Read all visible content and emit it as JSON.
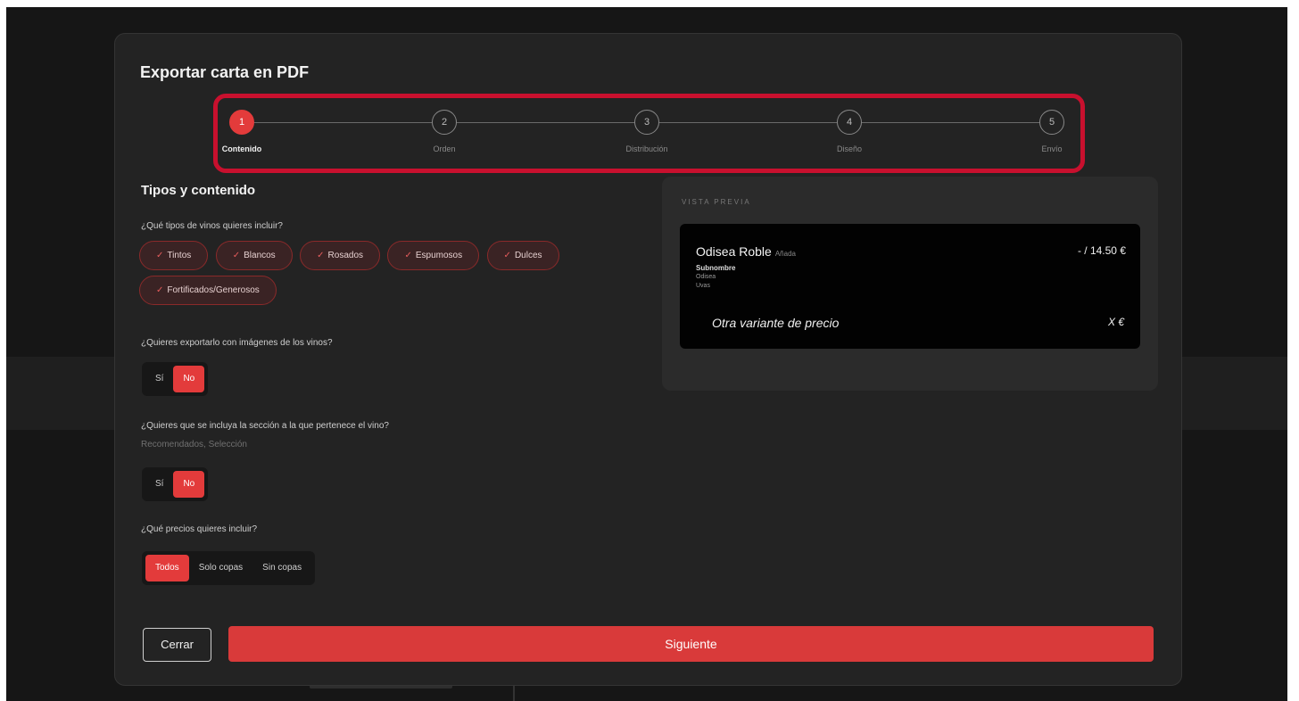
{
  "dialog": {
    "title": "Exportar carta en PDF"
  },
  "stepper": {
    "steps": [
      {
        "number": "1",
        "label": "Contenido",
        "active": true
      },
      {
        "number": "2",
        "label": "Orden",
        "active": false
      },
      {
        "number": "3",
        "label": "Distribución",
        "active": false
      },
      {
        "number": "4",
        "label": "Diseño",
        "active": false
      },
      {
        "number": "5",
        "label": "Envío",
        "active": false
      }
    ],
    "highlight_color": "#c8102e"
  },
  "content": {
    "section_title": "Tipos y contenido",
    "wine_types": {
      "question": "¿Qué tipos de vinos quieres incluir?",
      "check_glyph": "✓",
      "options": [
        "Tintos",
        "Blancos",
        "Rosados",
        "Espumosos",
        "Dulces",
        "Fortificados/Generosos"
      ]
    },
    "images": {
      "question": "¿Quieres exportarlo con imágenes de los vinos?",
      "yes": "Sí",
      "no": "No",
      "selected": "No"
    },
    "section_include": {
      "question": "¿Quieres que se incluya la sección a la que pertenece el vino?",
      "hint": "Recomendados, Selección",
      "yes": "Sí",
      "no": "No",
      "selected": "No"
    },
    "prices": {
      "question": "¿Qué precios quieres incluir?",
      "options": [
        "Todos",
        "Solo copas",
        "Sin copas"
      ],
      "selected": "Todos"
    }
  },
  "preview": {
    "title": "VISTA PREVIA",
    "wine_name": "Odisea Roble",
    "vintage": "Añada",
    "price": "- / 14.50 €",
    "subname": "Subnombre",
    "winery": "Odisea",
    "grape": "Uvas",
    "variant_label": "Otra variante de precio",
    "variant_price": "X €"
  },
  "footer": {
    "close_label": "Cerrar",
    "next_label": "Siguiente"
  },
  "colors": {
    "accent": "#e33b3b",
    "modal_bg": "#232323",
    "preview_card_bg": "#020202"
  }
}
